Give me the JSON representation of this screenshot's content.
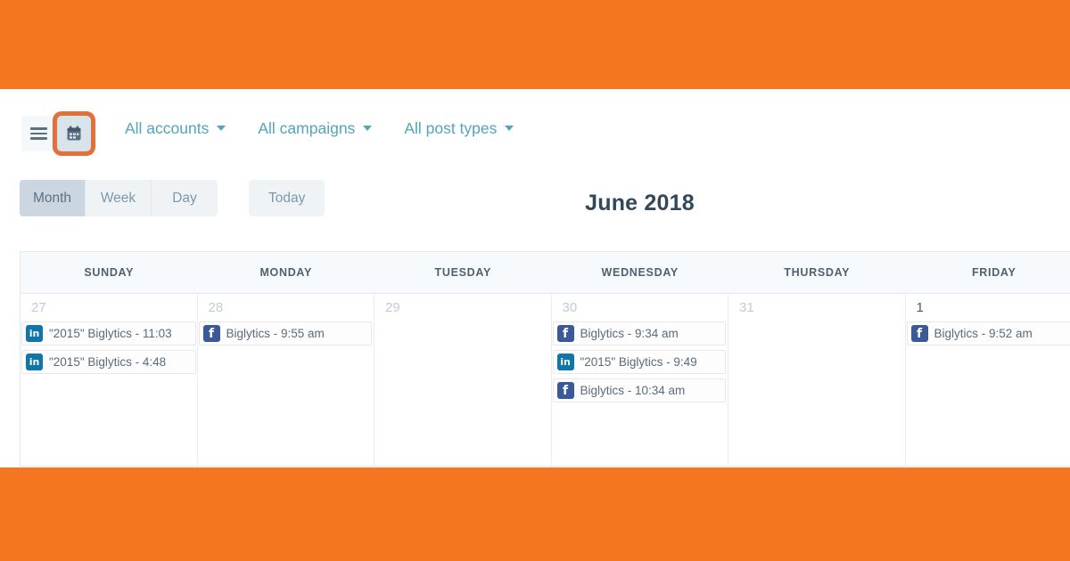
{
  "theme": {
    "band_color": "#F47621",
    "accent_teal": "#52A5BA",
    "highlight_ring": "#E2703A",
    "linkedin_color": "#0E76A8",
    "facebook_color": "#3B5998",
    "title_color": "#33475B"
  },
  "toolbar": {
    "menu_icon": "hamburger-icon",
    "calendar_icon": "calendar-icon",
    "dropdowns": [
      {
        "label": "All accounts"
      },
      {
        "label": "All campaigns"
      },
      {
        "label": "All post types"
      }
    ]
  },
  "views": {
    "segments": [
      {
        "label": "Month",
        "active": true
      },
      {
        "label": "Week",
        "active": false
      },
      {
        "label": "Day",
        "active": false
      }
    ],
    "today_label": "Today"
  },
  "calendar": {
    "title": "June 2018",
    "columns": [
      "SUNDAY",
      "MONDAY",
      "TUESDAY",
      "WEDNESDAY",
      "THURSDAY",
      "FRIDAY"
    ],
    "days": [
      {
        "number": "27",
        "current_month": false,
        "events": [
          {
            "network": "linkedin",
            "text": "\"2015\" Biglytics - 11:03"
          },
          {
            "network": "linkedin",
            "text": "\"2015\" Biglytics - 4:48"
          }
        ]
      },
      {
        "number": "28",
        "current_month": false,
        "events": [
          {
            "network": "facebook",
            "text": "Biglytics - 9:55 am"
          }
        ]
      },
      {
        "number": "29",
        "current_month": false,
        "events": []
      },
      {
        "number": "30",
        "current_month": false,
        "events": [
          {
            "network": "facebook",
            "text": "Biglytics - 9:34 am"
          },
          {
            "network": "linkedin",
            "text": "\"2015\" Biglytics - 9:49"
          },
          {
            "network": "facebook",
            "text": "Biglytics - 10:34 am"
          }
        ]
      },
      {
        "number": "31",
        "current_month": false,
        "events": []
      },
      {
        "number": "1",
        "current_month": true,
        "events": [
          {
            "network": "facebook",
            "text": "Biglytics - 9:52 am"
          }
        ]
      }
    ]
  }
}
